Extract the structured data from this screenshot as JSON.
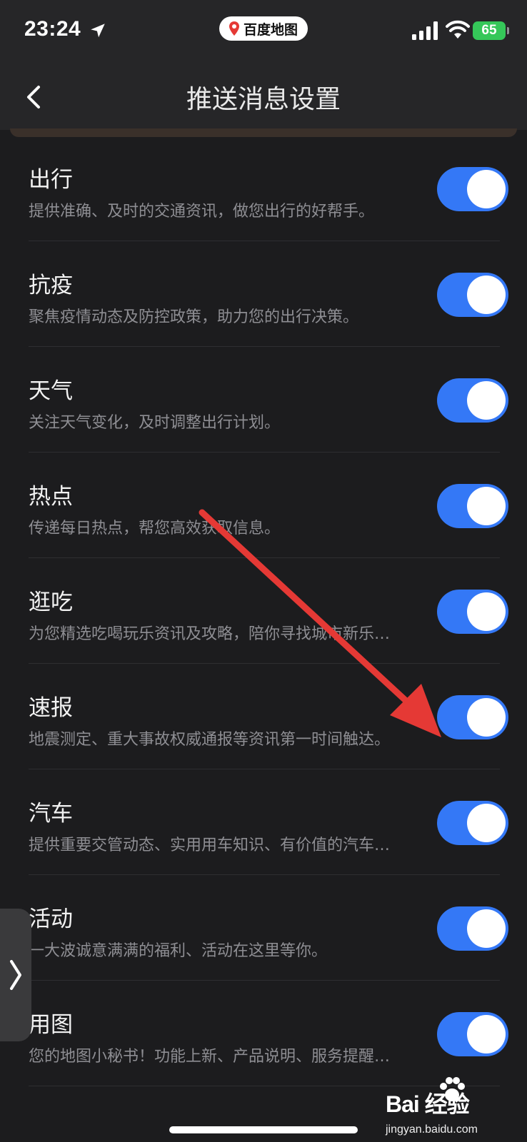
{
  "status_bar": {
    "time": "23:24",
    "app_name": "百度地图",
    "battery": "65",
    "location_icon": "location-arrow-icon",
    "signal_icon": "cellular-signal-icon",
    "wifi_icon": "wifi-icon"
  },
  "nav": {
    "title": "推送消息设置",
    "back_icon": "chevron-left-icon"
  },
  "settings": [
    {
      "title": "出行",
      "description": "提供准确、及时的交通资讯，做您出行的好帮手。",
      "enabled": true
    },
    {
      "title": "抗疫",
      "description": "聚焦疫情动态及防控政策，助力您的出行决策。",
      "enabled": true
    },
    {
      "title": "天气",
      "description": "关注天气变化，及时调整出行计划。",
      "enabled": true
    },
    {
      "title": "热点",
      "description": "传递每日热点，帮您高效获取信息。",
      "enabled": true
    },
    {
      "title": "逛吃",
      "description": "为您精选吃喝玩乐资讯及攻略，陪你寻找城市新乐…",
      "enabled": true
    },
    {
      "title": "速报",
      "description": "地震测定、重大事故权威通报等资讯第一时间触达。",
      "enabled": true
    },
    {
      "title": "汽车",
      "description": "提供重要交管动态、实用用车知识、有价值的汽车…",
      "enabled": true
    },
    {
      "title": "活动",
      "description": "一大波诚意满满的福利、活动在这里等你。",
      "enabled": true
    },
    {
      "title": "用图",
      "description": "您的地图小秘书！功能上新、产品说明、服务提醒…",
      "enabled": true
    }
  ],
  "colors": {
    "background": "#1c1c1e",
    "toggle_on": "#3478f6",
    "annotation_arrow": "#e53935"
  },
  "watermark": {
    "brand": "Bai 经验",
    "url": "jingyan.baidu.com"
  }
}
